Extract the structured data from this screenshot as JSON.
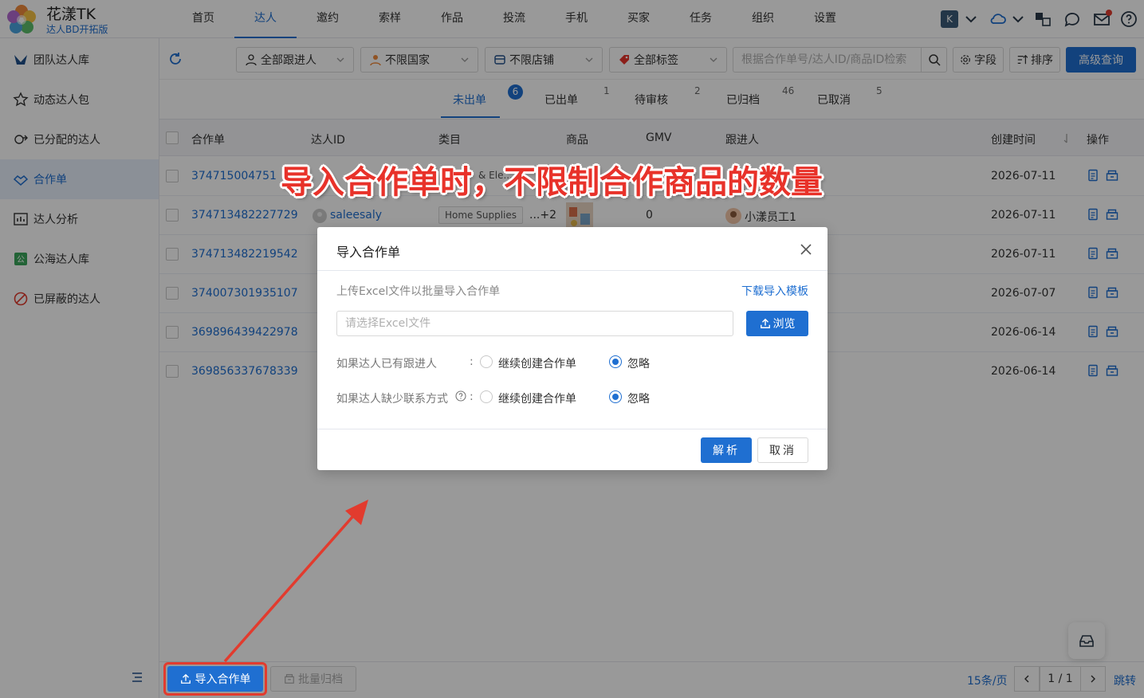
{
  "brand": {
    "title": "花漾TK",
    "subtitle": "达人BD开拓版"
  },
  "nav": [
    "首页",
    "达人",
    "邀约",
    "索样",
    "作品",
    "投流",
    "手机",
    "买家",
    "任务",
    "组织",
    "设置"
  ],
  "nav_active": "达人",
  "topbar": {
    "user_initial": "K"
  },
  "sidebar": {
    "items": [
      {
        "label": "团队达人库",
        "icon": "team-library-icon"
      },
      {
        "label": "动态达人包",
        "icon": "star-icon"
      },
      {
        "label": "已分配的达人",
        "icon": "assign-icon"
      },
      {
        "label": "合作单",
        "icon": "handshake-icon"
      },
      {
        "label": "达人分析",
        "icon": "chart-icon"
      },
      {
        "label": "公海达人库",
        "icon": "public-pool-icon"
      },
      {
        "label": "已屏蔽的达人",
        "icon": "block-icon"
      }
    ],
    "active": "合作单"
  },
  "toolbar": {
    "filters": [
      "全部跟进人",
      "不限国家",
      "不限店铺",
      "全部标签"
    ],
    "search_placeholder": "根据合作单号/达人ID/商品ID检索",
    "fields_label": "字段",
    "sort_label": "排序",
    "advanced_label": "高级查询"
  },
  "status_tabs": [
    {
      "label": "未出单",
      "count": "6"
    },
    {
      "label": "已出单",
      "count": "1"
    },
    {
      "label": "待审核",
      "count": "2"
    },
    {
      "label": "已归档",
      "count": "46"
    },
    {
      "label": "已取消",
      "count": "5"
    }
  ],
  "table": {
    "columns": [
      "合作单",
      "达人ID",
      "类目",
      "商品",
      "GMV",
      "跟进人",
      "创建时间",
      "操作"
    ],
    "rows": [
      {
        "order": "374715004751",
        "date": "2026-07-11"
      },
      {
        "order": "374713482227729",
        "creator": "saleesaly",
        "category": "Home Supplies",
        "more": "...+2",
        "gmv": "0",
        "follower": "小漾员工1",
        "date": "2026-07-11"
      },
      {
        "order": "374713482219542",
        "date": "2026-07-11"
      },
      {
        "order": "374007301935107",
        "date": "2026-07-07"
      },
      {
        "order": "369896439422978",
        "date": "2026-06-14"
      },
      {
        "order": "369856337678339",
        "date": "2026-06-14"
      }
    ],
    "row1_category_fragment": "& Ele..."
  },
  "footer": {
    "import_label": "导入合作单",
    "archive_label": "批量归档",
    "page_size": "15条/页",
    "page_indicator": "1 / 1",
    "jump_label": "跳转"
  },
  "dialog": {
    "title": "导入合作单",
    "hint": "上传Excel文件以批量导入合作单",
    "download_link": "下载导入模板",
    "file_placeholder": "请选择Excel文件",
    "browse_label": "浏览",
    "option1_label": "如果达人已有跟进人",
    "option2_label": "如果达人缺少联系方式",
    "colon": ":",
    "choice_continue": "继续创建合作单",
    "choice_ignore": "忽略",
    "option1_selected": "忽略",
    "option2_selected": "忽略",
    "ok_label": "解析",
    "cancel_label": "取消"
  },
  "annotation": {
    "text": "导入合作单时，不限制合作商品的数量"
  },
  "colors": {
    "accent": "#1f6fd1",
    "annotation": "#e8322a",
    "mask": "rgba(0,0,0,0.4)"
  }
}
